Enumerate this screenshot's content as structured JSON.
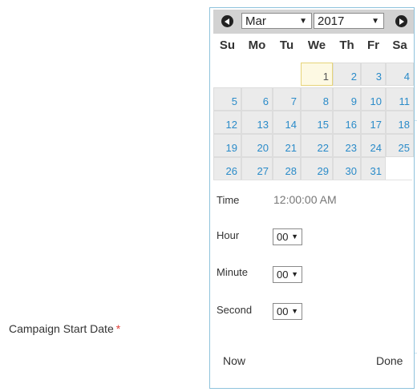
{
  "form": {
    "label": "Campaign Start Date",
    "required_marker": "*"
  },
  "picker": {
    "month": "Mar",
    "year": "2017",
    "weekdays": [
      "Su",
      "Mo",
      "Tu",
      "We",
      "Th",
      "Fr",
      "Sa"
    ],
    "days": [
      "1",
      "2",
      "3",
      "4",
      "5",
      "6",
      "7",
      "8",
      "9",
      "10",
      "11",
      "12",
      "13",
      "14",
      "15",
      "16",
      "17",
      "18",
      "19",
      "20",
      "21",
      "22",
      "23",
      "24",
      "25",
      "26",
      "27",
      "28",
      "29",
      "30",
      "31"
    ],
    "selected_day": "1",
    "time_label": "Time",
    "time_value": "12:00:00 AM",
    "hour_label": "Hour",
    "hour_value": "00",
    "minute_label": "Minute",
    "minute_value": "00",
    "second_label": "Second",
    "second_value": "00",
    "now_label": "Now",
    "done_label": "Done"
  }
}
